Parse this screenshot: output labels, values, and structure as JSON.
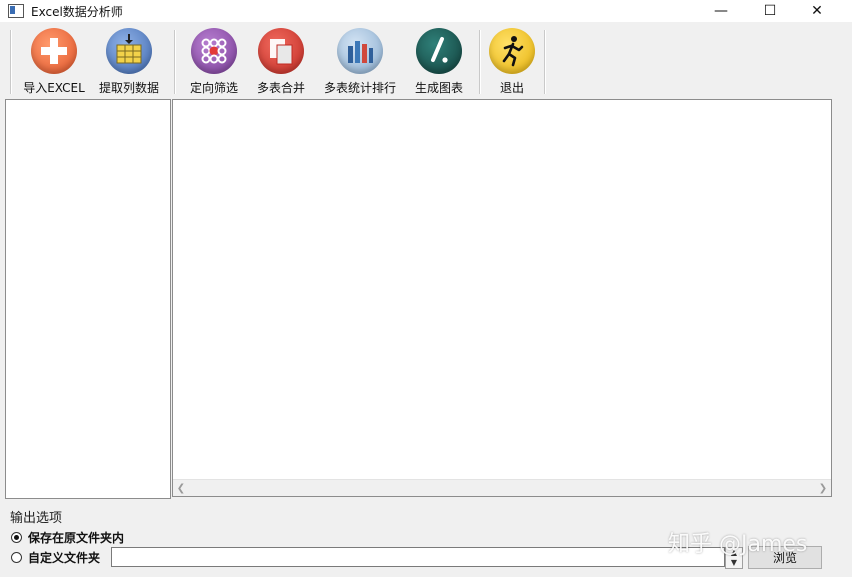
{
  "window": {
    "title": "Excel数据分析师",
    "minimize_glyph": "—",
    "maximize_glyph": "☐",
    "close_glyph": "✕"
  },
  "toolbar": {
    "buttons": [
      {
        "label": "导入EXCEL",
        "icon": "import-plus-icon",
        "color": "#e8633a"
      },
      {
        "label": "提取列数据",
        "icon": "extract-column-icon",
        "color": "#4f7fc4"
      },
      {
        "label": "定向筛选",
        "icon": "filter-dots-icon",
        "color": "#8a4fa6"
      },
      {
        "label": "多表合并",
        "icon": "merge-sheets-icon",
        "color": "#d23a2f"
      },
      {
        "label": "多表统计排行",
        "icon": "bar-ranking-icon",
        "color": "#8fb3d6"
      },
      {
        "label": "生成图表",
        "icon": "chart-pen-icon",
        "color": "#1d5e58"
      },
      {
        "label": "退出",
        "icon": "exit-runner-icon",
        "color": "#f2c417"
      }
    ]
  },
  "output": {
    "group_label": "输出选项",
    "option_original": "保存在原文件夹内",
    "option_custom": "自定义文件夹",
    "folder_value": "",
    "browse_label": "浏览"
  },
  "watermark": "知乎 @James"
}
